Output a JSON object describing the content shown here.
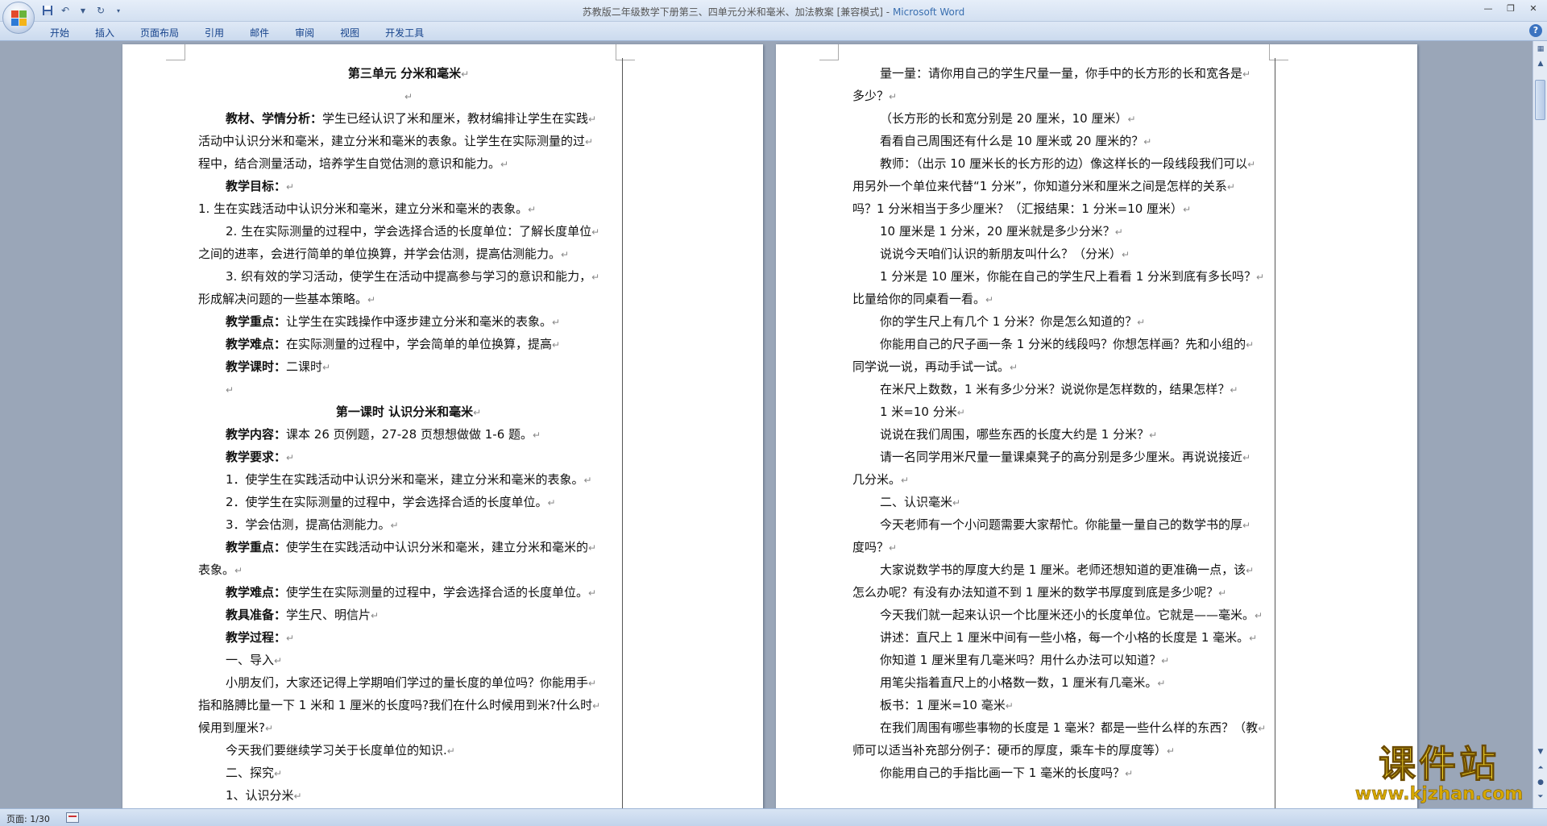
{
  "titlebar": {
    "document": "苏教版二年级数学下册第三、四单元分米和毫米、加法教案 [兼容模式]",
    "separator": " - ",
    "app": "Microsoft Word"
  },
  "ribbon": {
    "tabs": [
      "开始",
      "插入",
      "页面布局",
      "引用",
      "邮件",
      "审阅",
      "视图",
      "开发工具"
    ],
    "help": "?"
  },
  "status": {
    "page": "页面: 1/30"
  },
  "watermark": {
    "main": "课件站",
    "url": "www.kjzhan.com"
  },
  "page1": {
    "lines": [
      {
        "t": "第三单元  分米和毫米",
        "c": 1,
        "b": 1
      },
      {
        "t": "",
        "c": 1
      },
      {
        "b1": "教材、学情分析：",
        "t": "学生已经认识了米和厘米，教材编排让学生在实践",
        "i": 1
      },
      {
        "t": "活动中认识分米和毫米，建立分米和毫米的表象。让学生在实际测量的过"
      },
      {
        "t": "程中，结合测量活动，培养学生自觉估测的意识和能力。"
      },
      {
        "b1": "教学目标：",
        "t": "",
        "i": 1
      },
      {
        "t": "1.  生在实践活动中认识分米和毫米，建立分米和毫米的表象。"
      },
      {
        "t": "2. 生在实际测量的过程中，学会选择合适的长度单位：了解长度单位",
        "i": 1
      },
      {
        "t": "之间的进率，会进行简单的单位换算，并学会估测，提高估测能力。"
      },
      {
        "t": "3. 织有效的学习活动，使学生在活动中提高参与学习的意识和能力，",
        "i": 1
      },
      {
        "t": "形成解决问题的一些基本策略。"
      },
      {
        "b1": "教学重点：",
        "t": "让学生在实践操作中逐步建立分米和毫米的表象。",
        "i": 1
      },
      {
        "b1": "教学难点：",
        "t": "在实际测量的过程中，学会简单的单位换算，提高",
        "i": 1
      },
      {
        "b1": "教学课时：",
        "t": "二课时",
        "i": 1
      },
      {
        "t": "",
        "i": 1
      },
      {
        "t": "第一课时        认识分米和毫米",
        "c": 1,
        "b": 1
      },
      {
        "b1": "教学内容：",
        "t": "课本 26 页例题，27-28 页想想做做 1-6 题。",
        "i": 1
      },
      {
        "b1": "教学要求：",
        "t": "",
        "i": 1
      },
      {
        "t": "1．使学生在实践活动中认识分米和毫米，建立分米和毫米的表象。",
        "i": 1
      },
      {
        "t": "2．使学生在实际测量的过程中，学会选择合适的长度单位。",
        "i": 1
      },
      {
        "t": "3．学会估测，提高估测能力。",
        "i": 1
      },
      {
        "b1": "教学重点：",
        "t": "使学生在实践活动中认识分米和毫米，建立分米和毫米的",
        "i": 1
      },
      {
        "t": "表象。"
      },
      {
        "b1": "教学难点：",
        "t": "使学生在实际测量的过程中，学会选择合适的长度单位。",
        "i": 1
      },
      {
        "b1": "教具准备：",
        "t": "学生尺、明信片",
        "i": 1
      },
      {
        "b1": "教学过程：",
        "t": "",
        "i": 1
      },
      {
        "t": "一、导入",
        "i": 1
      },
      {
        "t": "小朋友们，大家还记得上学期咱们学过的量长度的单位吗？你能用手",
        "i": 1
      },
      {
        "t": "指和胳膊比量一下 1 米和 1 厘米的长度吗?我们在什么时候用到米?什么时"
      },
      {
        "t": "候用到厘米?"
      },
      {
        "t": "今天我们要继续学习关于长度单位的知识.",
        "i": 1
      },
      {
        "t": "二、探究",
        "i": 1
      },
      {
        "t": "1、认识分米",
        "i": 1
      }
    ]
  },
  "page2": {
    "lines": [
      {
        "t": "量一量：请你用自己的学生尺量一量，你手中的长方形的长和宽各是",
        "i": 1
      },
      {
        "t": "多少？"
      },
      {
        "t": "（长方形的长和宽分别是 20 厘米，10 厘米）",
        "i": 1
      },
      {
        "t": "看看自己周围还有什么是 10 厘米或 20 厘米的？",
        "i": 1
      },
      {
        "t": "教师：（出示 10 厘米长的长方形的边）像这样长的一段线段我们可以",
        "i": 1
      },
      {
        "t": "用另外一个单位来代替“1 分米”，你知道分米和厘米之间是怎样的关系"
      },
      {
        "t": "吗？1 分米相当于多少厘米？（汇报结果：1 分米=10 厘米）"
      },
      {
        "t": "10 厘米是 1 分米，20 厘米就是多少分米？",
        "i": 1
      },
      {
        "t": "说说今天咱们认识的新朋友叫什么？（分米）",
        "i": 1
      },
      {
        "t": "1 分米是 10 厘米，你能在自己的学生尺上看看 1 分米到底有多长吗？",
        "i": 1
      },
      {
        "t": "比量给你的同桌看一看。"
      },
      {
        "t": "你的学生尺上有几个 1 分米？你是怎么知道的？",
        "i": 1
      },
      {
        "t": "你能用自己的尺子画一条 1 分米的线段吗？你想怎样画？先和小组的",
        "i": 1
      },
      {
        "t": "同学说一说，再动手试一试。"
      },
      {
        "t": "在米尺上数数，1 米有多少分米？说说你是怎样数的，结果怎样？",
        "i": 1
      },
      {
        "t": "1 米=10 分米",
        "i": 1
      },
      {
        "t": "说说在我们周围，哪些东西的长度大约是 1 分米？",
        "i": 1
      },
      {
        "t": "请一名同学用米尺量一量课桌凳子的高分别是多少厘米。再说说接近",
        "i": 1
      },
      {
        "t": "几分米。"
      },
      {
        "t": "二、认识毫米",
        "i": 1
      },
      {
        "t": "今天老师有一个小问题需要大家帮忙。你能量一量自己的数学书的厚",
        "i": 1
      },
      {
        "t": "度吗？"
      },
      {
        "t": "大家说数学书的厚度大约是 1 厘米。老师还想知道的更准确一点，该",
        "i": 1
      },
      {
        "t": "怎么办呢？有没有办法知道不到 1 厘米的数学书厚度到底是多少呢？"
      },
      {
        "t": "今天我们就一起来认识一个比厘米还小的长度单位。它就是——毫米。",
        "i": 1
      },
      {
        "t": "讲述：直尺上 1 厘米中间有一些小格，每一个小格的长度是 1 毫米。",
        "i": 1
      },
      {
        "t": "你知道 1 厘米里有几毫米吗？用什么办法可以知道？",
        "i": 1
      },
      {
        "t": "用笔尖指着直尺上的小格数一数，1 厘米有几毫米。",
        "i": 1
      },
      {
        "t": "板书：1 厘米=10 毫米",
        "i": 1
      },
      {
        "t": "在我们周围有哪些事物的长度是 1 毫米？都是一些什么样的东西？（教",
        "i": 1
      },
      {
        "t": "师可以适当补充部分例子：硬币的厚度，乘车卡的厚度等）"
      },
      {
        "t": "你能用自己的手指比画一下 1 毫米的长度吗？",
        "i": 1
      }
    ]
  }
}
